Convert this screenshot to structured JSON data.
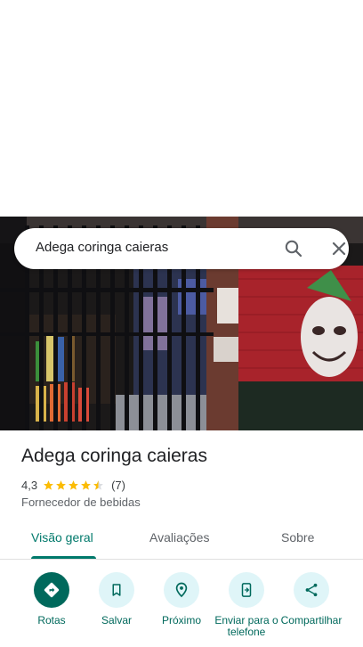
{
  "search": {
    "query": "Adega coringa caieras"
  },
  "place": {
    "name": "Adega coringa caieras",
    "rating": "4,3",
    "stars": 4.5,
    "review_count": "(7)",
    "category": "Fornecedor de bebidas"
  },
  "tabs": [
    {
      "label": "Visão geral"
    },
    {
      "label": "Avaliações"
    },
    {
      "label": "Sobre"
    }
  ],
  "actions": [
    {
      "label": "Rotas",
      "icon": "directions-icon"
    },
    {
      "label": "Salvar",
      "icon": "bookmark-icon"
    },
    {
      "label": "Próximo",
      "icon": "nearby-icon"
    },
    {
      "label": "Enviar para o telefone",
      "icon": "send-to-phone-icon"
    },
    {
      "label": "Compartilhar",
      "icon": "share-icon"
    }
  ],
  "colors": {
    "accent": "#00796b",
    "action_bg": "#dff5f8",
    "star": "#fbbc04"
  }
}
